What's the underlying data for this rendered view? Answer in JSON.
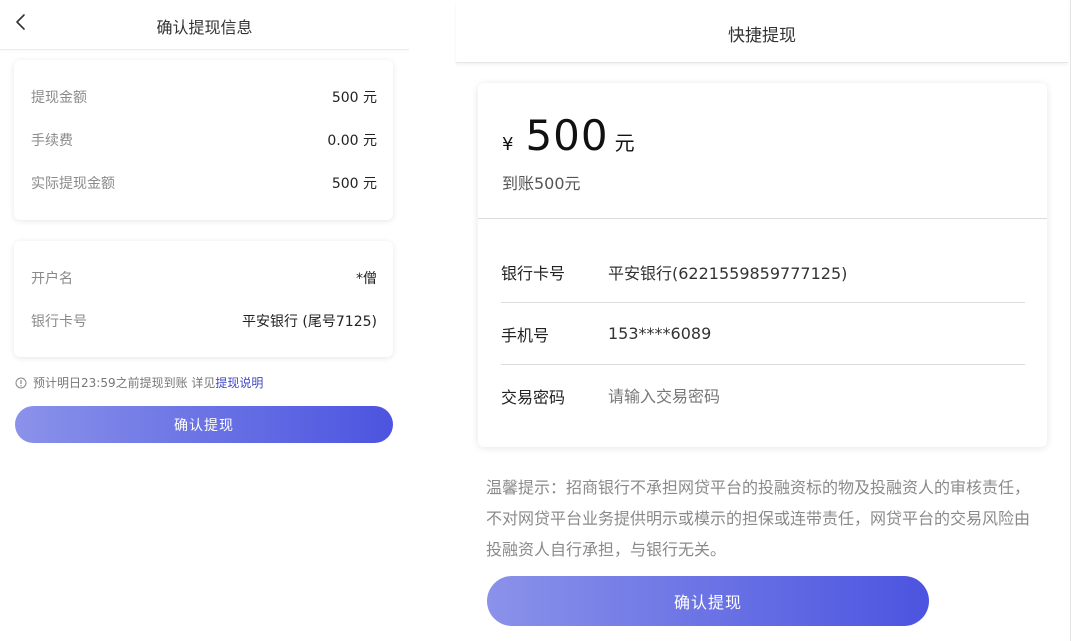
{
  "left": {
    "header": {
      "title": "确认提现信息"
    },
    "summary": [
      {
        "label": "提现金额",
        "value": "500 元"
      },
      {
        "label": "手续费",
        "value": "0.00 元"
      },
      {
        "label": "实际提现金额",
        "value": "500 元"
      }
    ],
    "account": [
      {
        "label": "开户名",
        "value": "*僧"
      },
      {
        "label": "银行卡号",
        "value": "平安银行 (尾号7125)"
      }
    ],
    "note": {
      "text": "预计明日23:59之前提现到账 详见",
      "link": "提现说明"
    },
    "confirm_button": "确认提现"
  },
  "right": {
    "header": {
      "title": "快捷提现"
    },
    "amount": {
      "currency_symbol": "¥",
      "value": "500",
      "unit": "元"
    },
    "arrival_text": "到账500元",
    "rows": {
      "bank_card": {
        "label": "银行卡号",
        "value": "平安银行(6221559859777125)"
      },
      "phone": {
        "label": "手机号",
        "value": "153****6089"
      },
      "password": {
        "label": "交易密码",
        "placeholder": "请输入交易密码"
      }
    },
    "tip": "温馨提示：招商银行不承担网贷平台的投融资标的物及投融资人的审核责任，不对网贷平台业务提供明示或模示的担保或连带责任，网贷平台的交易风险由投融资人自行承担，与银行无关。",
    "confirm_button": "确认提现"
  },
  "colors": {
    "accent": "#4c54e0",
    "accent_light": "#8a92ea",
    "link": "#4048c9"
  },
  "icons": [
    "back-arrow-icon",
    "info-circle-icon"
  ]
}
